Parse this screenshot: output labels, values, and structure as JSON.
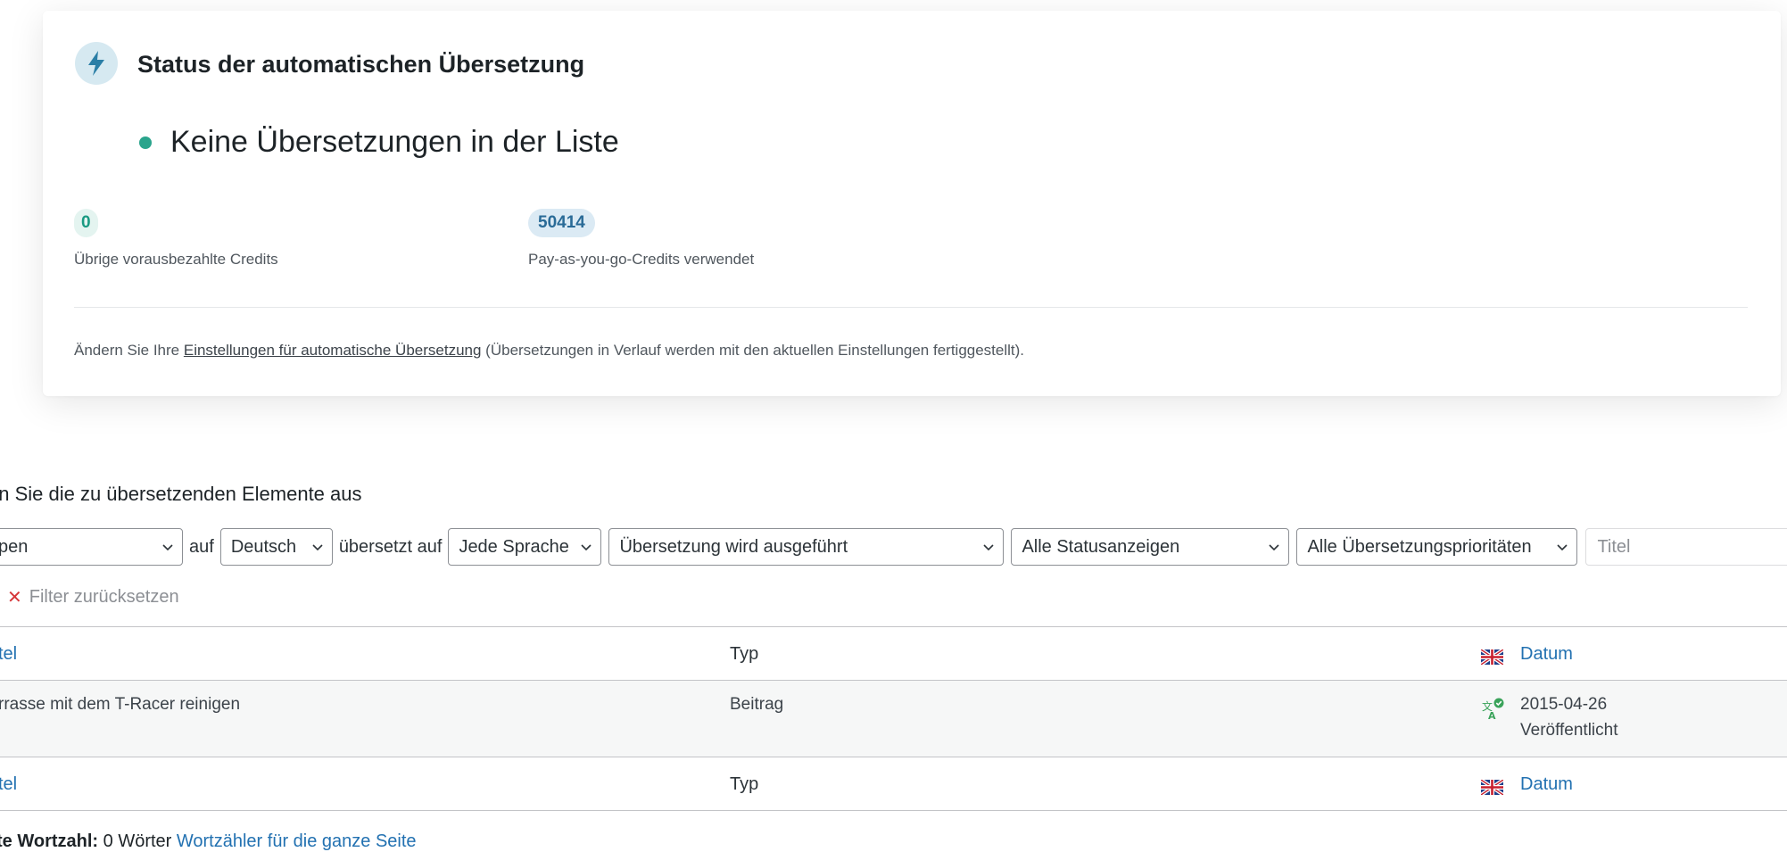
{
  "status_card": {
    "title": "Status der automatischen Übersetzung",
    "status_text": "Keine Übersetzungen in der Liste",
    "credits": [
      {
        "value": "0",
        "label": "Übrige vorausbezahlte Credits"
      },
      {
        "value": "50414",
        "label": "Pay-as-you-go-Credits verwendet"
      }
    ],
    "footnote_prefix": "Ändern Sie Ihre ",
    "footnote_link": "Einstellungen für automatische Übersetzung",
    "footnote_suffix": " (Übersetzungen in Verlauf werden mit den aktuellen Einstellungen fertiggestellt)."
  },
  "filters": {
    "heading": "en Sie die zu übersetzenden Elemente aus",
    "type_select": "pen",
    "text_auf": "auf",
    "language_select": "Deutsch",
    "text_translated_to": "übersetzt auf",
    "target_language_select": "Jede Sprache",
    "translation_status_select": "Übersetzung wird ausgeführt",
    "status_select": "Alle Statusanzeigen",
    "priority_select": "Alle Übersetzungsprioritäten",
    "title_placeholder": "Titel",
    "reset_label": "Filter zurücksetzen"
  },
  "table": {
    "columns": {
      "title": "tel",
      "type": "Typ",
      "date": "Datum"
    },
    "rows": [
      {
        "title": "rrasse mit dem T-Racer reinigen",
        "type": "Beitrag",
        "date": "2015-04-26",
        "status": "Veröffentlicht"
      }
    ]
  },
  "word_count": {
    "label": "zte Wortzahl:",
    "value": " 0 Wörter ",
    "link": "Wortzähler für die ganze Seite"
  },
  "colors": {
    "accent": "#2271b1",
    "status_dot": "#2aa48c"
  }
}
